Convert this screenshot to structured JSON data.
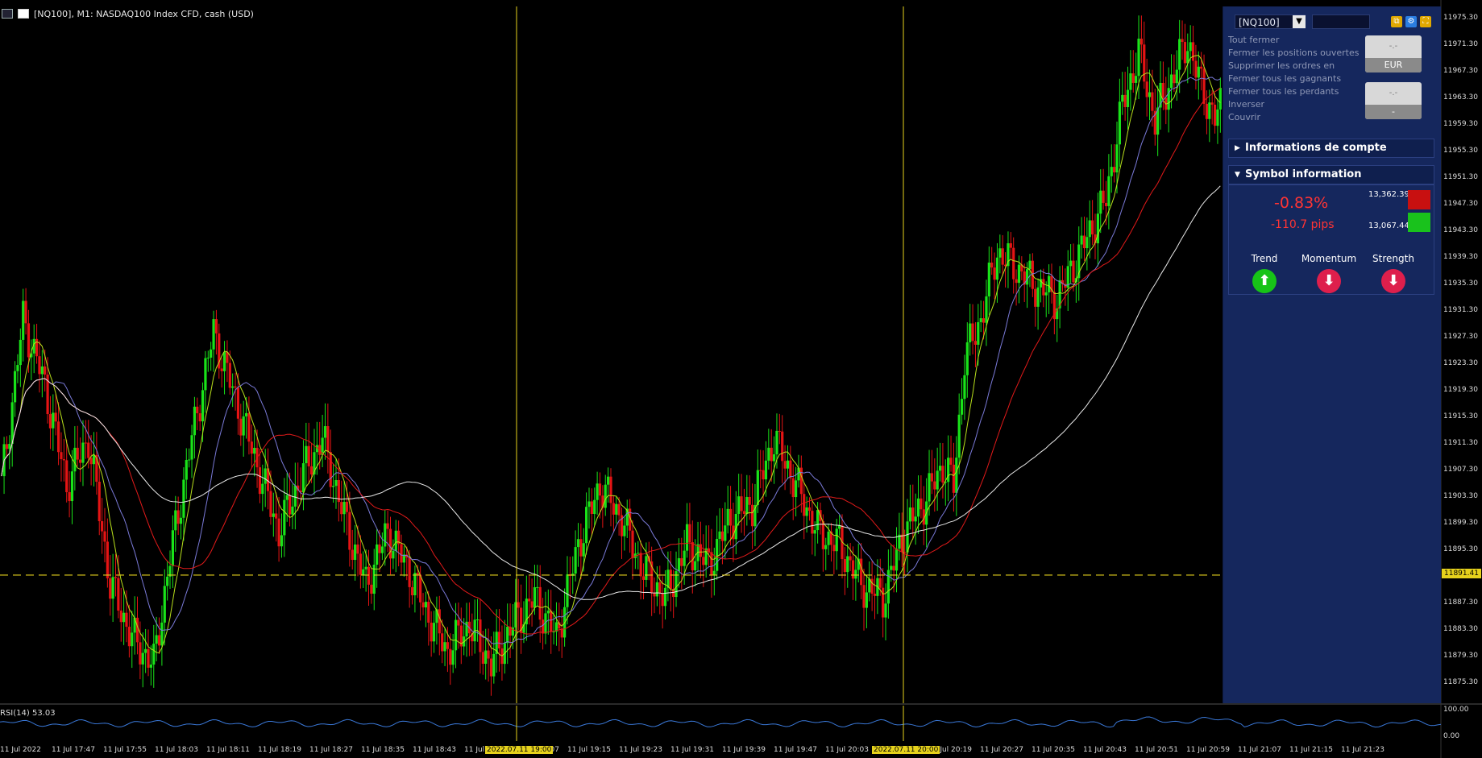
{
  "window": {
    "title": "[NQ100], M1:  NASDAQ100 Index CFD, cash (USD)"
  },
  "price_axis": {
    "labels": [
      "11975.30",
      "11971.30",
      "11967.30",
      "11963.30",
      "11959.30",
      "11955.30",
      "11951.30",
      "11947.30",
      "11943.30",
      "11939.30",
      "11935.30",
      "11931.30",
      "11927.30",
      "11923.30",
      "11919.30",
      "11915.30",
      "11911.30",
      "11907.30",
      "11903.30",
      "11899.30",
      "11895.30",
      "11891.41",
      "11887.30",
      "11883.30",
      "11879.30",
      "11875.30"
    ],
    "current_price": "11891.41"
  },
  "time_axis": {
    "labels": [
      "11 Jul 2022",
      "11 Jul 17:47",
      "11 Jul 17:55",
      "11 Jul 18:03",
      "11 Jul 18:11",
      "11 Jul 18:19",
      "11 Jul 18:27",
      "11 Jul 18:35",
      "11 Jul 18:43",
      "11 Jul 18:51",
      "11 Jul 19:07",
      "11 Jul 19:15",
      "11 Jul 19:23",
      "11 Jul 19:31",
      "11 Jul 19:39",
      "11 Jul 19:47",
      "11 Jul 20:03",
      "11 Jul 20:11",
      "11 Jul 20:19",
      "11 Jul 20:27",
      "11 Jul 20:35",
      "11 Jul 20:43",
      "11 Jul 20:51",
      "11 Jul 20:59",
      "11 Jul 21:07",
      "11 Jul 21:15",
      "11 Jul 21:23"
    ],
    "highlight_1": "2022.07.11 19:00",
    "highlight_2": "2022.07.11 20:00"
  },
  "rsi": {
    "title": "RSI(14) 53.03",
    "max": "100.00",
    "min": "0.00"
  },
  "panel": {
    "symbol": "[NQ100]",
    "actions": [
      "Tout fermer",
      "Fermer les positions ouvertes",
      "Supprimer les ordres en",
      "Fermer tous les gagnants",
      "Fermer tous les perdants",
      "Inverser",
      "Couvrir"
    ],
    "box1_top": "-.-",
    "box1_bottom": "EUR",
    "box2_top": "-.-",
    "box2_bottom": "-",
    "account_section": "Informations de compte",
    "symbol_section": "Symbol information",
    "change_pct": "-0.83%",
    "change_pips": "-110.7 pips",
    "high": "13,362.39",
    "low": "13,067.44",
    "indicators": [
      {
        "label": "Trend",
        "direction": "up"
      },
      {
        "label": "Momentum",
        "direction": "down"
      },
      {
        "label": "Strength",
        "direction": "down"
      }
    ]
  },
  "colors": {
    "bull": "#19e319",
    "bear": "#e51414",
    "ma_yellow": "#b9e01c",
    "ma_blue": "#7a7ad8",
    "ma_red": "#e21a1a",
    "ma_white": "#e8e8e8",
    "accent": "#e6d21c",
    "panel": "#15275d"
  },
  "chart_data": {
    "type": "candlestick",
    "symbol": "[NQ100]",
    "timeframe": "M1",
    "y_range": [
      11872,
      11977
    ],
    "current_price": 11891.41,
    "keypoints": [
      [
        0,
        11905
      ],
      [
        8,
        11930
      ],
      [
        16,
        11920
      ],
      [
        24,
        11905
      ],
      [
        32,
        11912
      ],
      [
        40,
        11890
      ],
      [
        48,
        11882
      ],
      [
        56,
        11878
      ],
      [
        62,
        11894
      ],
      [
        70,
        11912
      ],
      [
        78,
        11928
      ],
      [
        86,
        11918
      ],
      [
        94,
        11908
      ],
      [
        102,
        11898
      ],
      [
        110,
        11906
      ],
      [
        118,
        11912
      ],
      [
        126,
        11900
      ],
      [
        134,
        11890
      ],
      [
        142,
        11898
      ],
      [
        150,
        11892
      ],
      [
        156,
        11886
      ],
      [
        164,
        11880
      ],
      [
        172,
        11884
      ],
      [
        180,
        11878
      ],
      [
        188,
        11884
      ],
      [
        196,
        11888
      ],
      [
        204,
        11882
      ],
      [
        212,
        11896
      ],
      [
        220,
        11905
      ],
      [
        228,
        11900
      ],
      [
        236,
        11892
      ],
      [
        244,
        11888
      ],
      [
        252,
        11896
      ],
      [
        260,
        11893
      ],
      [
        268,
        11900
      ],
      [
        276,
        11902
      ],
      [
        284,
        11912
      ],
      [
        292,
        11905
      ],
      [
        300,
        11898
      ],
      [
        308,
        11896
      ],
      [
        316,
        11890
      ],
      [
        324,
        11888
      ],
      [
        332,
        11898
      ],
      [
        340,
        11903
      ],
      [
        346,
        11908
      ],
      [
        350,
        11905
      ],
      [
        354,
        11924
      ],
      [
        360,
        11930
      ],
      [
        366,
        11940
      ],
      [
        372,
        11938
      ],
      [
        380,
        11935
      ],
      [
        388,
        11933
      ],
      [
        394,
        11938
      ],
      [
        400,
        11943
      ],
      [
        406,
        11948
      ],
      [
        412,
        11962
      ],
      [
        418,
        11970
      ],
      [
        424,
        11960
      ],
      [
        430,
        11966
      ],
      [
        436,
        11972
      ],
      [
        440,
        11966
      ],
      [
        446,
        11960
      ],
      [
        448,
        11962
      ]
    ],
    "moving_averages": [
      {
        "name": "MA yellow",
        "color": "#b9e01c"
      },
      {
        "name": "MA blue",
        "color": "#7a7ad8"
      },
      {
        "name": "MA red",
        "color": "#e21a1a"
      },
      {
        "name": "MA white",
        "color": "#e8e8e8"
      }
    ],
    "rsi_value": 53.03,
    "rsi_range": [
      0,
      100
    ]
  }
}
